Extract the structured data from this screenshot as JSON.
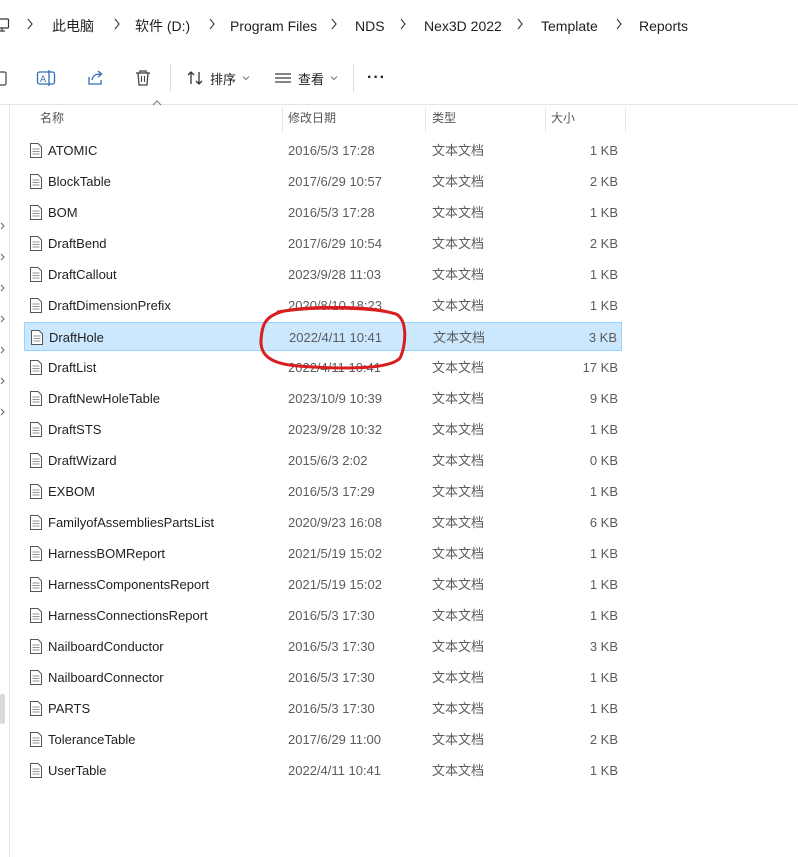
{
  "breadcrumb": [
    {
      "label": "此电脑"
    },
    {
      "label": "软件 (D:)"
    },
    {
      "label": "Program Files"
    },
    {
      "label": "NDS"
    },
    {
      "label": "Nex3D 2022"
    },
    {
      "label": "Template"
    },
    {
      "label": "Reports"
    }
  ],
  "toolbar": {
    "sort_label": "排序",
    "view_label": "查看",
    "more_label": "···"
  },
  "columns": {
    "name": "名称",
    "date": "修改日期",
    "type": "类型",
    "size": "大小"
  },
  "files": [
    {
      "name": "ATOMIC",
      "date": "2016/5/3 17:28",
      "type": "文本文档",
      "size": "1 KB"
    },
    {
      "name": "BlockTable",
      "date": "2017/6/29 10:57",
      "type": "文本文档",
      "size": "2 KB"
    },
    {
      "name": "BOM",
      "date": "2016/5/3 17:28",
      "type": "文本文档",
      "size": "1 KB"
    },
    {
      "name": "DraftBend",
      "date": "2017/6/29 10:54",
      "type": "文本文档",
      "size": "2 KB"
    },
    {
      "name": "DraftCallout",
      "date": "2023/9/28 11:03",
      "type": "文本文档",
      "size": "1 KB"
    },
    {
      "name": "DraftDimensionPrefix",
      "date": "2020/8/10 18:23",
      "type": "文本文档",
      "size": "1 KB"
    },
    {
      "name": "DraftHole",
      "date": "2022/4/11 10:41",
      "type": "文本文档",
      "size": "3 KB",
      "selected": true
    },
    {
      "name": "DraftList",
      "date": "2022/4/11 10:41",
      "type": "文本文档",
      "size": "17 KB"
    },
    {
      "name": "DraftNewHoleTable",
      "date": "2023/10/9 10:39",
      "type": "文本文档",
      "size": "9 KB"
    },
    {
      "name": "DraftSTS",
      "date": "2023/9/28 10:32",
      "type": "文本文档",
      "size": "1 KB"
    },
    {
      "name": "DraftWizard",
      "date": "2015/6/3 2:02",
      "type": "文本文档",
      "size": "0 KB"
    },
    {
      "name": "EXBOM",
      "date": "2016/5/3 17:29",
      "type": "文本文档",
      "size": "1 KB"
    },
    {
      "name": "FamilyofAssembliesPartsList",
      "date": "2020/9/23 16:08",
      "type": "文本文档",
      "size": "6 KB"
    },
    {
      "name": "HarnessBOMReport",
      "date": "2021/5/19 15:02",
      "type": "文本文档",
      "size": "1 KB"
    },
    {
      "name": "HarnessComponentsReport",
      "date": "2021/5/19 15:02",
      "type": "文本文档",
      "size": "1 KB"
    },
    {
      "name": "HarnessConnectionsReport",
      "date": "2016/5/3 17:30",
      "type": "文本文档",
      "size": "1 KB"
    },
    {
      "name": "NailboardConductor",
      "date": "2016/5/3 17:30",
      "type": "文本文档",
      "size": "3 KB"
    },
    {
      "name": "NailboardConnector",
      "date": "2016/5/3 17:30",
      "type": "文本文档",
      "size": "1 KB"
    },
    {
      "name": "PARTS",
      "date": "2016/5/3 17:30",
      "type": "文本文档",
      "size": "1 KB"
    },
    {
      "name": "ToleranceTable",
      "date": "2017/6/29 11:00",
      "type": "文本文档",
      "size": "2 KB"
    },
    {
      "name": "UserTable",
      "date": "2022/4/11 10:41",
      "type": "文本文档",
      "size": "1 KB"
    }
  ],
  "icons": {
    "computer": "computer-icon",
    "rename": "rename-icon",
    "share": "share-icon",
    "delete": "trash-icon",
    "sort": "sort-icon",
    "view": "view-list-icon",
    "file": "text-document-icon"
  },
  "colors": {
    "selection_bg": "#cce8ff",
    "selection_border": "#99d1ff",
    "accent_blue": "#0067c0",
    "annotation_red": "#d81e1e"
  }
}
